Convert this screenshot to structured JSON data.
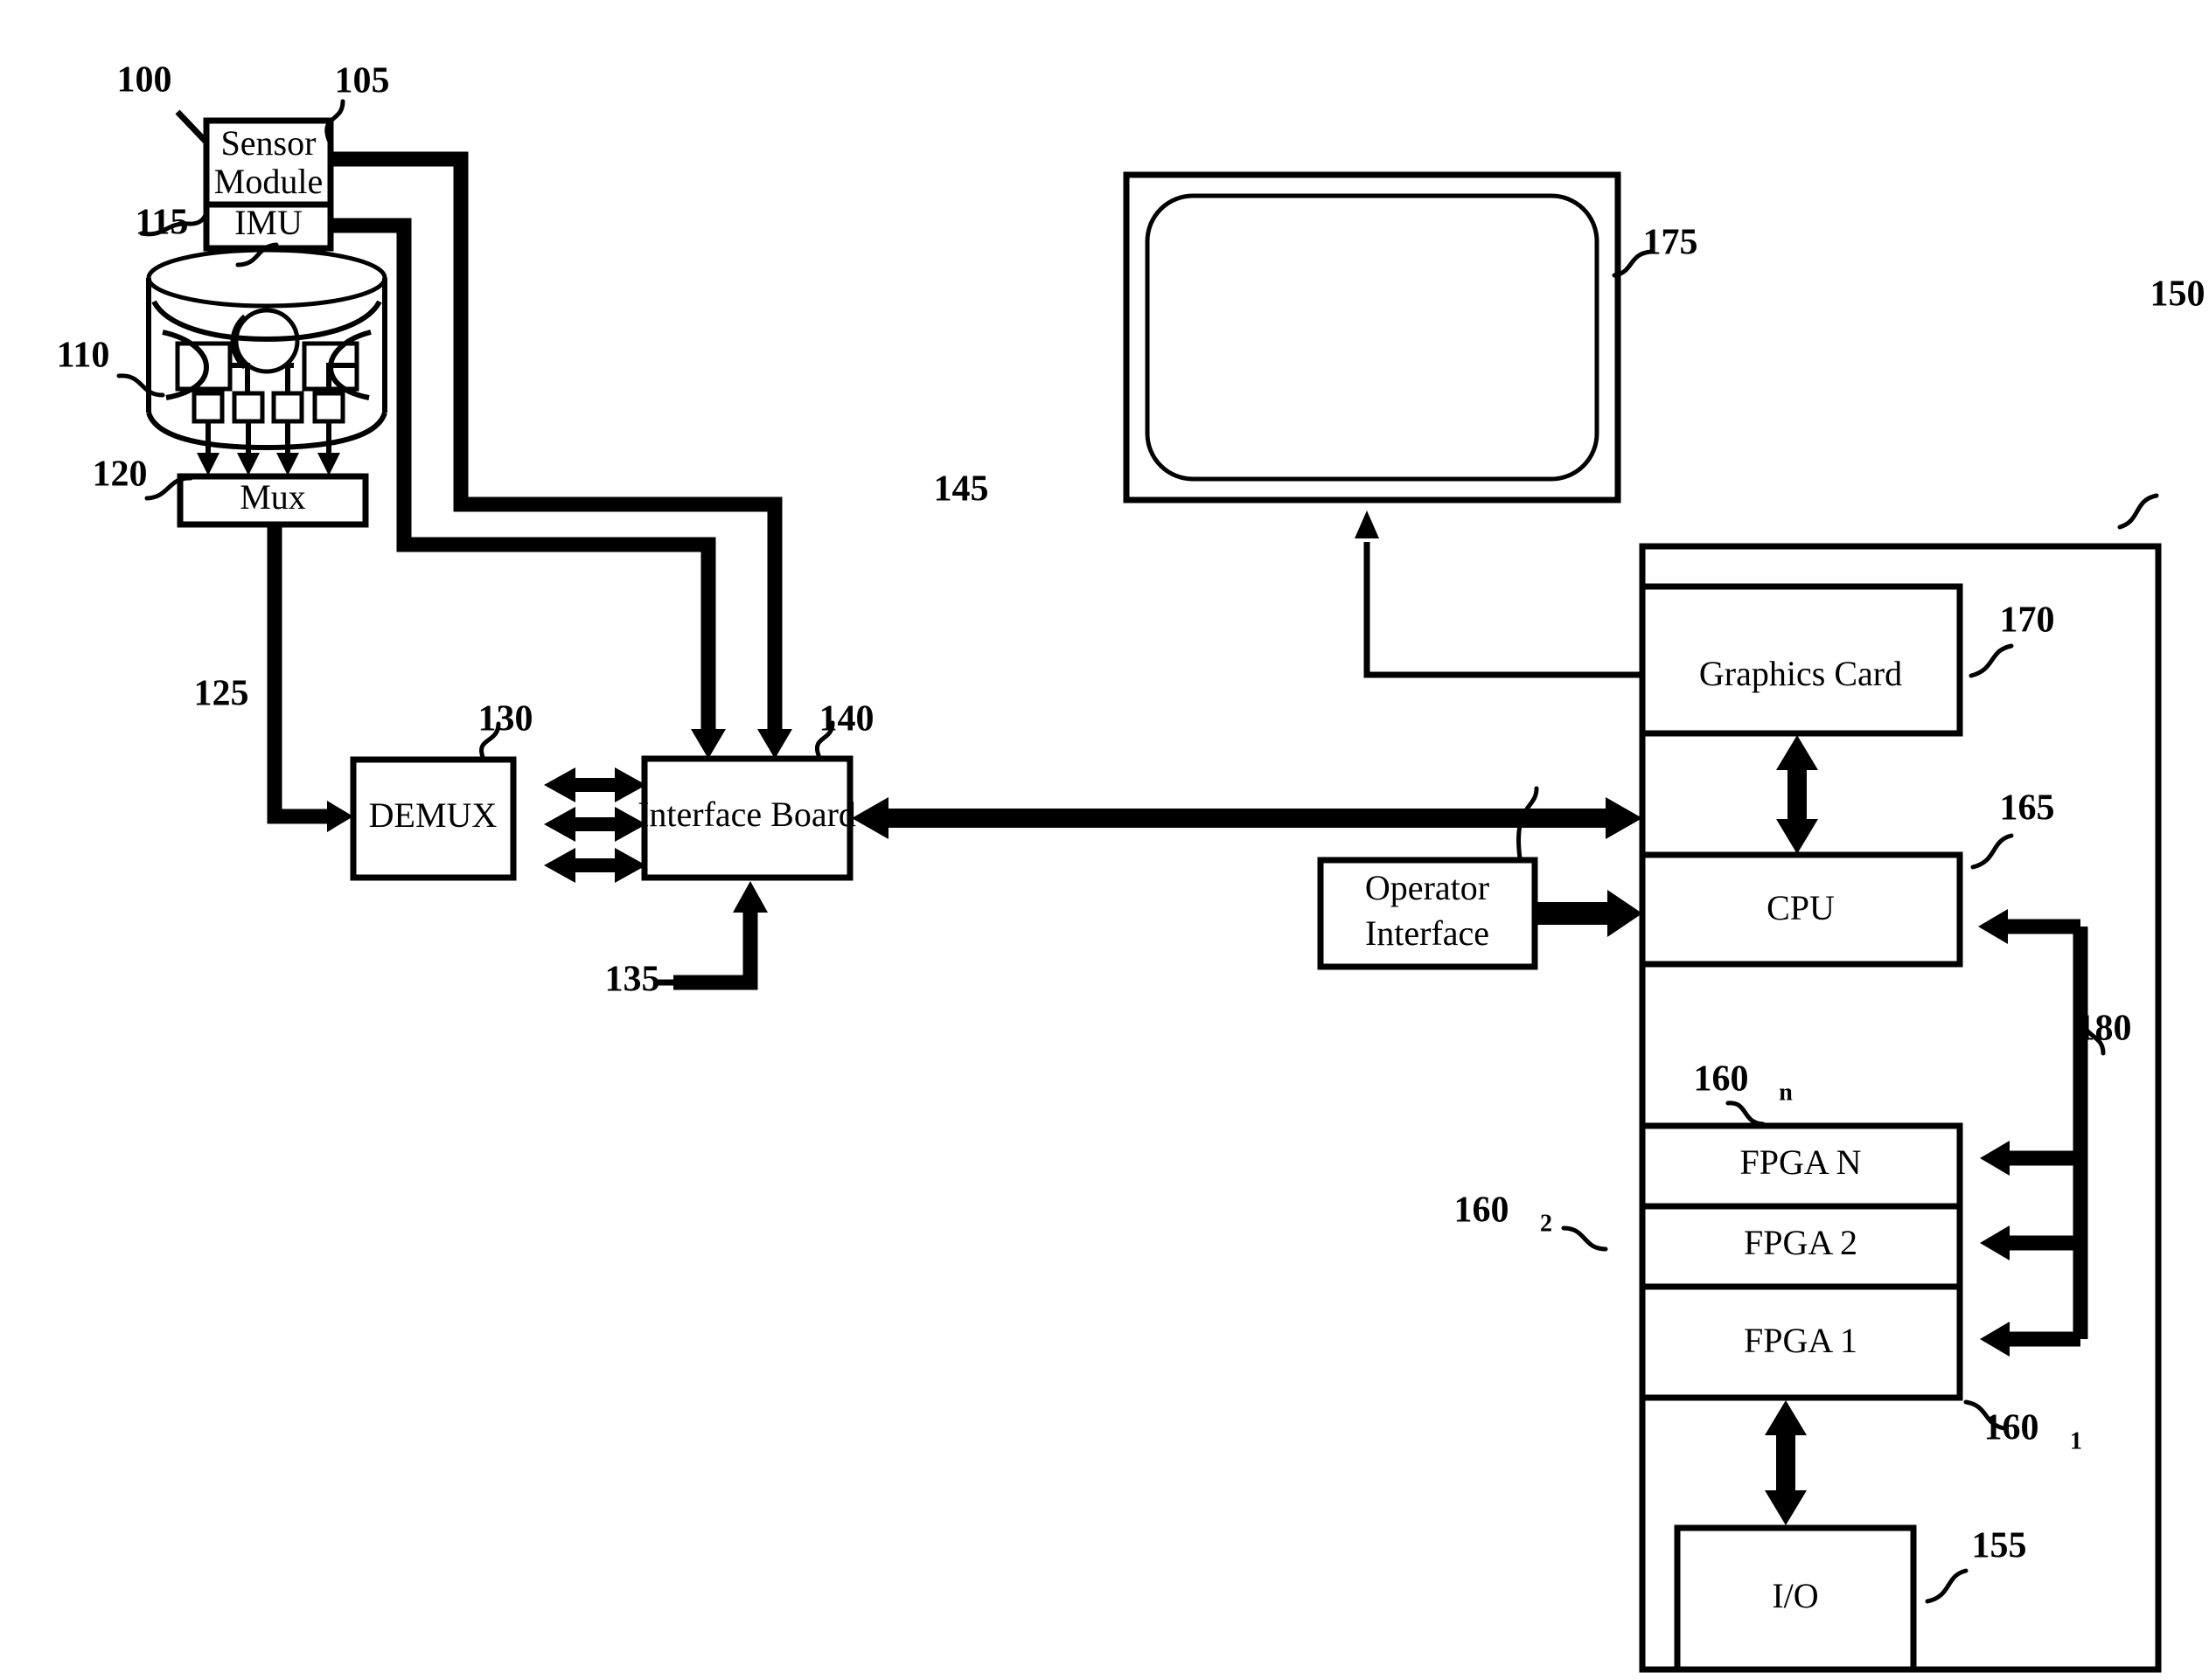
{
  "figure": {
    "title_ref": "100",
    "description": "Patent block diagram of a multi-camera sensor system connected to a computer",
    "line_color": "#000000",
    "background_color": "#ffffff"
  },
  "blocks": {
    "sensor_module": {
      "label": "Sensor Module",
      "ref": "105"
    },
    "imu": {
      "label": "IMU",
      "ref": "115"
    },
    "camera_ring": {
      "label": "",
      "ref": "110"
    },
    "mux": {
      "label": "Mux",
      "ref": "120"
    },
    "demux": {
      "label": "DEMUX",
      "ref": "130"
    },
    "interface_board": {
      "label": "Interface Board",
      "ref": "140"
    },
    "operator_interface": {
      "label": "Operator Interface",
      "ref": "145"
    },
    "monitor": {
      "label": "",
      "ref": "175"
    },
    "computer_chassis": {
      "label": "",
      "ref": "150"
    },
    "graphics_card": {
      "label": "Graphics Card",
      "ref": "170"
    },
    "cpu": {
      "label": "CPU",
      "ref": "165"
    },
    "fpga_n": {
      "label": "FPGA N",
      "ref": "160",
      "ref_sub": "n"
    },
    "fpga_2": {
      "label": "FPGA 2",
      "ref": "160",
      "ref_sub": "2"
    },
    "fpga_1": {
      "label": "FPGA 1",
      "ref": "160",
      "ref_sub": "1"
    },
    "io": {
      "label": "I/O",
      "ref": "155"
    }
  },
  "connections": {
    "mux_to_demux_ref": "125",
    "external_input_to_interface_ref": "135",
    "fpga_bus_ref": "180"
  },
  "reference_numerals": [
    "100",
    "105",
    "110",
    "115",
    "120",
    "125",
    "130",
    "135",
    "140",
    "145",
    "150",
    "155",
    "160",
    "165",
    "170",
    "175",
    "180"
  ]
}
